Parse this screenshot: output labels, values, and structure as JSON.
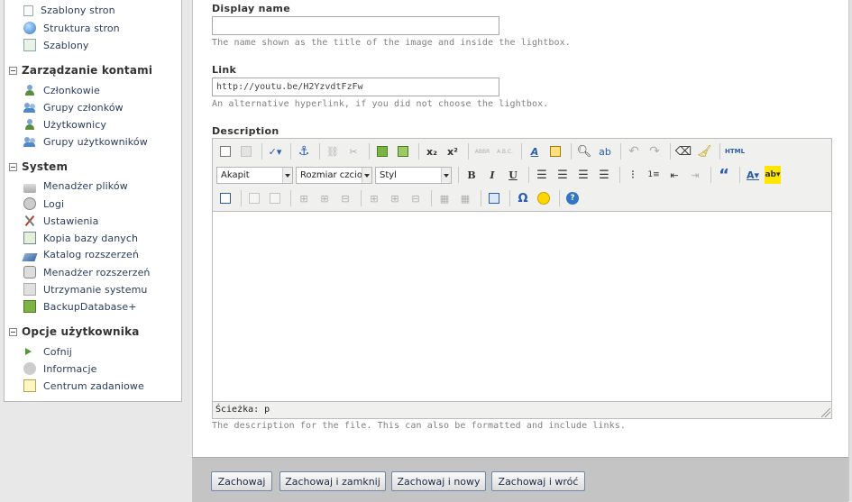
{
  "sidebar": {
    "top_items": [
      {
        "label": "Szablony stron",
        "icon": "page-icon"
      },
      {
        "label": "Struktura stron",
        "icon": "globe-icon"
      },
      {
        "label": "Szablony",
        "icon": "template-icon"
      }
    ],
    "groups": [
      {
        "title": "Zarządzanie kontami",
        "items": [
          {
            "label": "Członkowie",
            "icon": "user-icon"
          },
          {
            "label": "Grupy członków",
            "icon": "users-icon"
          },
          {
            "label": "Użytkownicy",
            "icon": "user-icon"
          },
          {
            "label": "Grupy użytkowników",
            "icon": "users-icon"
          }
        ]
      },
      {
        "title": "System",
        "items": [
          {
            "label": "Menadżer plików",
            "icon": "files-icon"
          },
          {
            "label": "Logi",
            "icon": "logs-icon"
          },
          {
            "label": "Ustawienia",
            "icon": "tools-icon"
          },
          {
            "label": "Kopia bazy danych",
            "icon": "database-icon"
          },
          {
            "label": "Katalog rozszerzeń",
            "icon": "catalog-icon"
          },
          {
            "label": "Menadżer rozszerzeń",
            "icon": "extension-icon"
          },
          {
            "label": "Utrzymanie systemu",
            "icon": "maintenance-icon"
          },
          {
            "label": "BackupDatabase+",
            "icon": "backup-icon"
          }
        ]
      },
      {
        "title": "Opcje użytkownika",
        "items": [
          {
            "label": "Cofnij",
            "icon": "back-icon"
          },
          {
            "label": "Informacje",
            "icon": "info-icon"
          },
          {
            "label": "Centrum zadaniowe",
            "icon": "task-icon"
          }
        ]
      }
    ]
  },
  "form": {
    "display_name": {
      "label": "Display name",
      "value": "",
      "hint": "The name shown as the title of the image and inside the lightbox."
    },
    "link": {
      "label": "Link",
      "value": "http://youtu.be/H2YzvdtFzFw",
      "hint": "An alternative hyperlink, if you did not choose the lightbox."
    },
    "description": {
      "label": "Description",
      "hint": "The description for the file. This can also be formatted and include links."
    }
  },
  "editor": {
    "format_select": "Akapit",
    "size_select": "Rozmiar czcion",
    "style_select": "Styl",
    "html_button": "HTML",
    "path_label": "Ścieżka: p",
    "bold": "B",
    "italic": "I",
    "underline": "U",
    "quote": "“",
    "omega": "Ω",
    "abbr1": "ABBR",
    "abbr2": "A.B.C.",
    "sub": "x₂",
    "sup": "x²"
  },
  "footer": {
    "save": "Zachowaj",
    "save_close": "Zachowaj i zamknij",
    "save_new": "Zachowaj i nowy",
    "save_back": "Zachowaj i wróć"
  },
  "colors": {
    "accent": "#2b3d5c",
    "button_border": "#6f86a8",
    "footer_bg": "#c4c4c4"
  }
}
